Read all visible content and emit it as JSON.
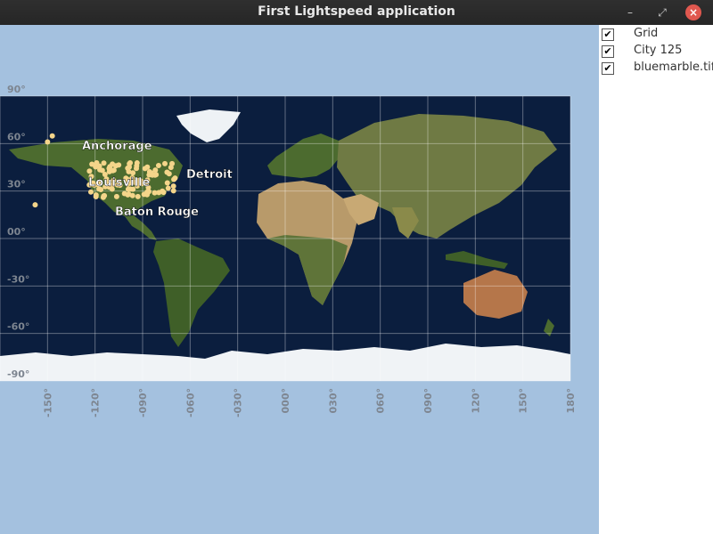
{
  "window": {
    "title": "First Lightspeed application",
    "minimize": "–",
    "maximize": "⤢",
    "close": "×"
  },
  "layers": [
    {
      "label": "Grid",
      "checked": "✔"
    },
    {
      "label": "City 125",
      "checked": "✔"
    },
    {
      "label": "bluemarble.tif",
      "checked": "✔"
    }
  ],
  "map": {
    "lat_labels": [
      "90°",
      "60°",
      "30°",
      "00°",
      "-30°",
      "-60°",
      "-90°"
    ],
    "lon_labels": [
      "-150°",
      "-120°",
      "-090°",
      "-060°",
      "-030°",
      "000°",
      "030°",
      "060°",
      "090°",
      "120°",
      "150°",
      "180°"
    ],
    "cities": [
      {
        "name": "Anchorage",
        "lon": -150,
        "lat": 61
      },
      {
        "name": "Louisville",
        "lon": -86,
        "lat": 38
      },
      {
        "name": "Detroit",
        "lon": -83,
        "lat": 42
      },
      {
        "name": "Baton Rouge",
        "lon": -91,
        "lat": 30
      }
    ],
    "colors": {
      "ocean": "#0b1e3e",
      "land": "#4c6b2f",
      "desert": "#b89a6a",
      "ice": "#f0f3f6",
      "points": "#f4d58a",
      "background": "#a4c1df"
    }
  }
}
